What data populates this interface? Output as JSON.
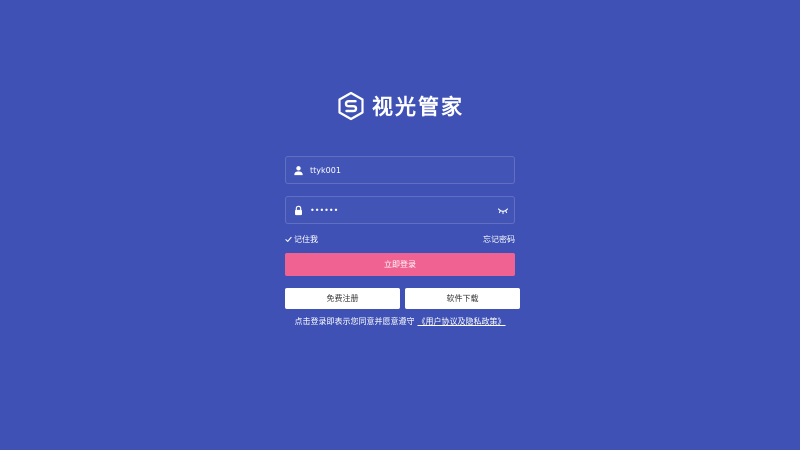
{
  "colors": {
    "background": "#3f51b5",
    "primary_button": "#f06291",
    "secondary_button": "#ffffff",
    "secondary_button_text": "#333333",
    "text": "#ffffff"
  },
  "brand": {
    "name": "视光管家",
    "logo_icon": "hexagon-s-logo-icon"
  },
  "login_form": {
    "username": {
      "value": "ttyk001",
      "icon": "user-icon"
    },
    "password": {
      "value": "••••••",
      "icon": "lock-icon",
      "toggle_icon": "eye-closed-icon"
    },
    "remember_me": {
      "label": "记住我",
      "checked": true,
      "icon": "check-icon"
    },
    "forgot_password": "忘记密码",
    "login_button": "立即登录"
  },
  "secondary_actions": {
    "register_button": "免费注册",
    "download_button": "软件下载"
  },
  "agreement": {
    "text": "点击登录即表示您同意并愿意遵守",
    "link": "《用户协议及隐私政策》"
  }
}
